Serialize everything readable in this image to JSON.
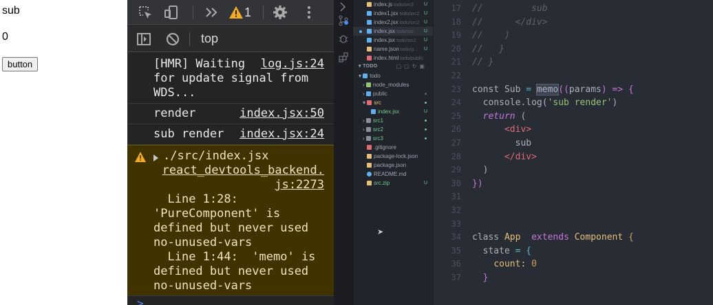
{
  "page": {
    "sub_text": "sub",
    "count_text": "0",
    "button_label": "button"
  },
  "devtools": {
    "toolbar": {
      "warning_count": "1",
      "icons": [
        "inspect-element-icon",
        "device-toolbar-icon",
        "more-tabs-icon",
        "warning-icon",
        "settings-gear-icon",
        "kebab-menu-icon"
      ]
    },
    "filter": {
      "context": "top",
      "icons": [
        "show-sidebar-icon",
        "clear-console-icon"
      ]
    },
    "messages": [
      {
        "text": "[HMR] Waiting for update signal from WDS...",
        "text_line1": "[HMR] Waiting",
        "text_rest": "for update signal from WDS...",
        "source": "log.js:24"
      },
      {
        "text": "render",
        "source": "index.jsx:50"
      },
      {
        "text": "sub render",
        "source": "index.jsx:24"
      }
    ],
    "warning": {
      "path": "./src/index.jsx",
      "source_line1": "react_devtools_backend.",
      "source_line2": "js:2273",
      "body": "  Line 1:28:\n'PureComponent' is\ndefined but never used\nno-unused-vars\n  Line 1:44:  'memo' is\ndefined but never used\nno-unused-vars"
    },
    "prompt": ">",
    "accent_color": "#4c8bf5",
    "warning_bg": "#413300"
  },
  "explorer": {
    "open_editors": [
      {
        "name": "index.js",
        "hint": "todo/src3",
        "mark": "U",
        "icon_color": "#e5c07b"
      },
      {
        "name": "index1.jsx",
        "hint": "todo/src2",
        "mark": "U",
        "icon_color": "#61afef"
      },
      {
        "name": "index2.jsx",
        "hint": "todo/src2",
        "mark": "U",
        "icon_color": "#61afef"
      },
      {
        "name": "index.jsx",
        "hint": "todo/src",
        "mark": "U",
        "icon_color": "#61afef"
      },
      {
        "name": "index.jsx",
        "hint": "todo/src2",
        "mark": "U",
        "icon_color": "#61afef"
      },
      {
        "name": "name.json",
        "hint": "todo/p...",
        "mark": "U",
        "icon_color": "#e5c07b"
      },
      {
        "name": "index.html",
        "hint": "todo/public",
        "mark": "",
        "icon_color": "#e06c75"
      }
    ],
    "section_title": "TODO",
    "tree": [
      {
        "name": "todo",
        "icon_color": "#61afef"
      },
      {
        "name": "node_modules",
        "icon_color": "#98c379"
      },
      {
        "name": "public",
        "icon_color": "#61afef"
      },
      {
        "name": "src",
        "icon_color": "#e06c75",
        "modified": true
      },
      {
        "name": "index.jsx",
        "icon_color": "#61afef",
        "mark": "U"
      },
      {
        "name": "src1",
        "icon_color": "#8a8f99"
      },
      {
        "name": "src2",
        "icon_color": "#8a8f99"
      },
      {
        "name": "src3",
        "icon_color": "#8a8f99"
      },
      {
        "name": ".gitignore",
        "icon_color": "#e06c75"
      },
      {
        "name": "package-lock.json",
        "icon_color": "#e5c07b"
      },
      {
        "name": "package.json",
        "icon_color": "#e5c07b"
      },
      {
        "name": "README.md",
        "icon_color": "#61afef"
      },
      {
        "name": "src.zip",
        "icon_color": "#e5c07b",
        "mark": "U"
      }
    ]
  },
  "code": {
    "line_numbers": [
      "17",
      "18",
      "19",
      "20",
      "21",
      "22",
      "23",
      "24",
      "25",
      "26",
      "27",
      "28",
      "29",
      "30",
      "31",
      "32",
      "33",
      "34",
      "35",
      "36",
      "37"
    ],
    "tokens": {
      "c17": "//         sub",
      "c18": "//      </div>",
      "c19": "//    )",
      "c20": "//   }",
      "c21": "// }",
      "const": "const",
      "sub_name": "Sub",
      "eq": " = ",
      "memo": "memo",
      "params_open": "((",
      "params": "params",
      "params_close": ") => {",
      "console_log": "console.log(",
      "sub_render_str": "'sub render'",
      "paren_close": ")",
      "return_kw": "return",
      "paren_open": " (",
      "div_open": "<div>",
      "sub_text": "sub",
      "div_close": "</div>",
      "close_paren": ")",
      "close_brace": "})",
      "class_kw": "class",
      "app_name": "App",
      "extends_kw": "extends",
      "component_name": "Component",
      "open_brace": " {",
      "state": "state",
      "eq2": " = {",
      "count_key": "count: ",
      "count_val": "0",
      "state_close": "}"
    }
  }
}
